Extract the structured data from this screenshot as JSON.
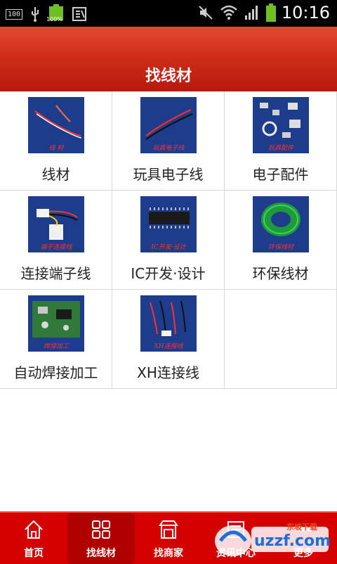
{
  "status_bar": {
    "time": "10:16",
    "battery_badge": "100",
    "battery_percent": "100%",
    "icons": [
      "battery-indicator-icon",
      "usb-icon",
      "battery-icon",
      "keyboard-icon",
      "mute-icon",
      "wifi-icon",
      "signal-icon",
      "battery-full-icon"
    ]
  },
  "header": {
    "title": "找线材"
  },
  "grid": {
    "items": [
      {
        "label": "线材",
        "caption": "线 材"
      },
      {
        "label": "玩具电子线",
        "caption": "玩具电子线"
      },
      {
        "label": "电子配件",
        "caption": "玩具配件"
      },
      {
        "label": "连接端子线",
        "caption": "端子连接线"
      },
      {
        "label": "IC开发·设计",
        "caption": "IC开发·设计"
      },
      {
        "label": "环保线材",
        "caption": "环保线材"
      },
      {
        "label": "自动焊接加工",
        "caption": "焊接加工"
      },
      {
        "label": "XH连接线",
        "caption": "XH连接线"
      }
    ]
  },
  "tabbar": {
    "tabs": [
      {
        "label": "首页",
        "icon": "home-icon"
      },
      {
        "label": "找线材",
        "icon": "grid-icon",
        "active": true
      },
      {
        "label": "找商家",
        "icon": "store-icon"
      },
      {
        "label": "资讯中心",
        "icon": "news-icon"
      },
      {
        "label": "更多",
        "icon": "more-icon"
      }
    ]
  },
  "watermark": {
    "text": "uzzf.com",
    "sub": "东坡下载"
  },
  "colors": {
    "header_top": "#e34a32",
    "header_bottom": "#b8180c",
    "tabbar": "#d40000",
    "thumb_bg": "#1e3c8c"
  }
}
